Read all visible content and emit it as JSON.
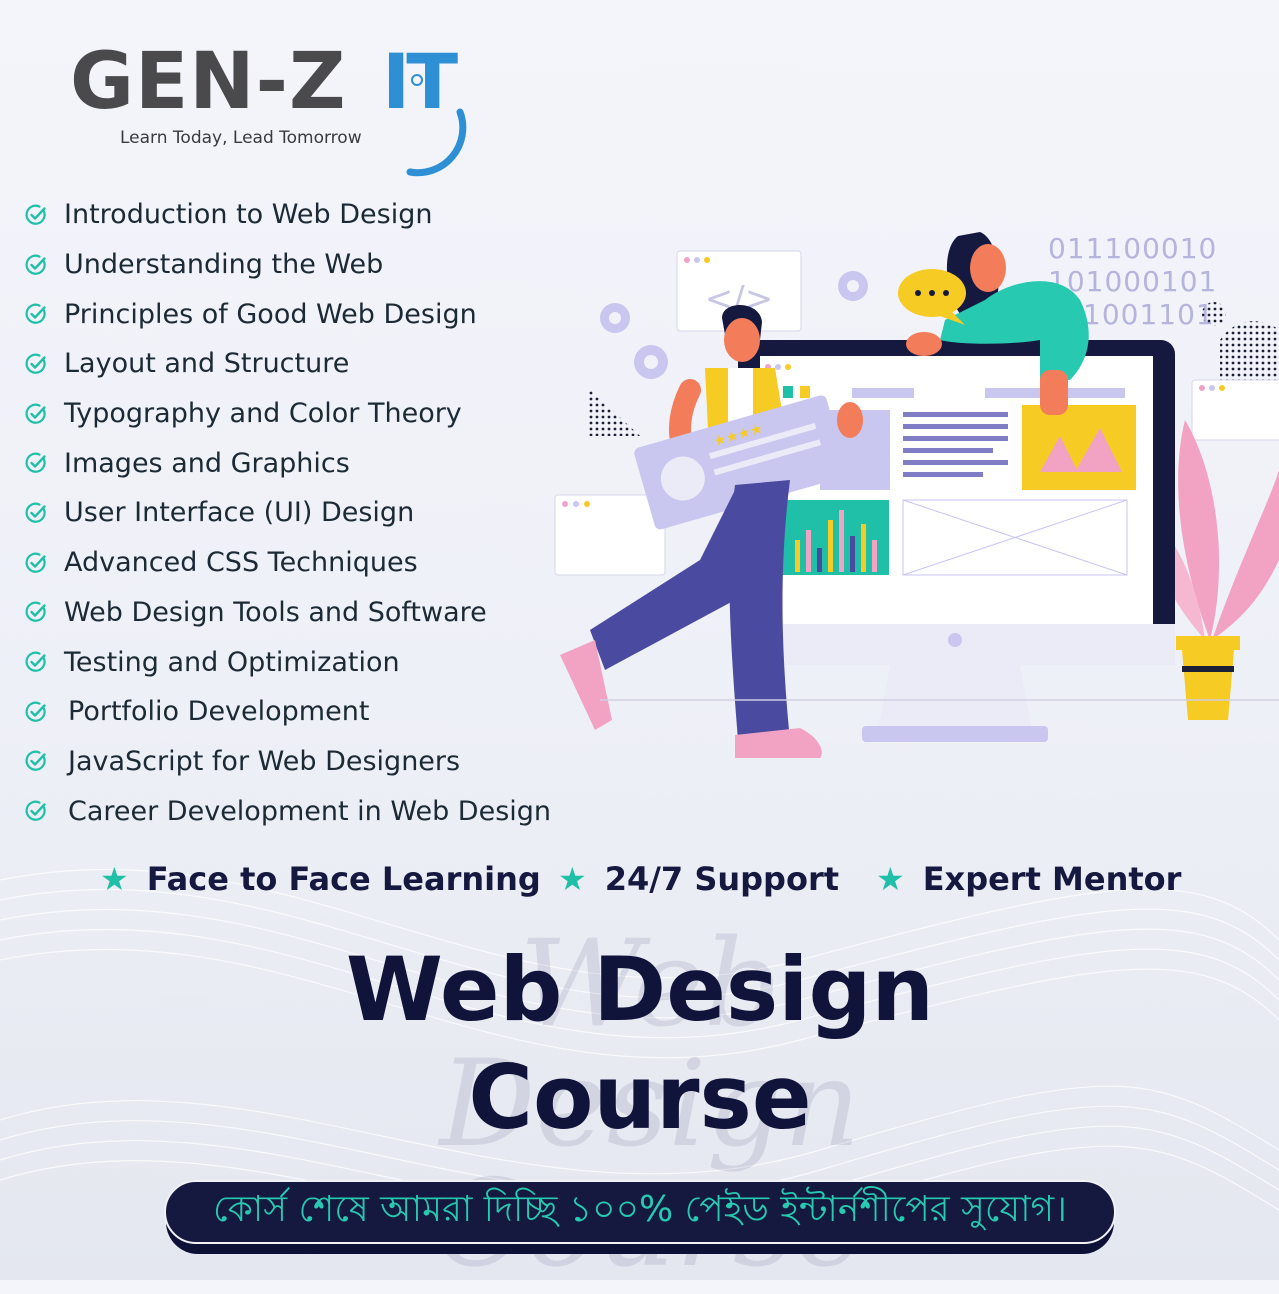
{
  "brand": {
    "name": "GEN-Z",
    "suffix": "IT",
    "tagline": "Learn Today, Lead Tomorrow",
    "colors": {
      "text": "#4a4a4c",
      "accent": "#2e8fd4"
    }
  },
  "topics": [
    "Introduction to Web Design",
    "Understanding the Web",
    "Principles of Good Web Design",
    "Layout and Structure",
    "Typography and Color Theory",
    "Images and Graphics",
    "User Interface (UI) Design",
    "Advanced CSS Techniques",
    "Web Design Tools and Software",
    "Testing and Optimization",
    "Portfolio Development",
    "JavaScript for Web Designers",
    "Career Development in Web Design"
  ],
  "list_icon": "check-circle-icon",
  "features": [
    {
      "icon": "star-icon",
      "label": "Face to Face Learning"
    },
    {
      "icon": "star-icon",
      "label": "24/7 Support"
    },
    {
      "icon": "star-icon",
      "label": "Expert Mentor"
    }
  ],
  "title": {
    "line1": "Web Design",
    "line2": "Course",
    "script_watermark": "Web Design Course"
  },
  "banner": {
    "text": "কোর্স শেষে আমরা দিচ্ছি ১০০% পেইড ইন্টার্নশীপের সুযোগ।"
  },
  "illustration": {
    "binary_lines": [
      "011100010",
      "101000101",
      "1001101"
    ],
    "code_symbol": "</>"
  },
  "colors": {
    "accent_teal": "#1fbfa8",
    "navy": "#15183f",
    "monitor": "#16193f",
    "purple": "#4a4aa0",
    "yellow": "#f6cb23",
    "pink": "#f2a3c3"
  }
}
